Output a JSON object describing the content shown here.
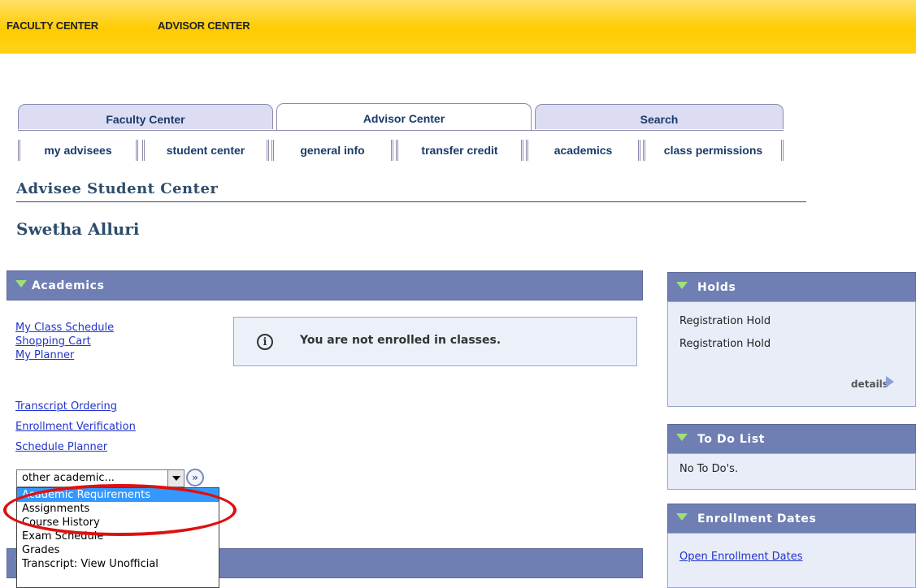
{
  "topbar": {
    "faculty_center": "FACULTY CENTER",
    "advisor_center": "ADVISOR CENTER"
  },
  "main_tabs": [
    {
      "label": "Faculty Center"
    },
    {
      "label": "Advisor Center"
    },
    {
      "label": "Search"
    }
  ],
  "sub_tabs": [
    {
      "label": "my advisees"
    },
    {
      "label": "student center"
    },
    {
      "label": "general info"
    },
    {
      "label": "transfer credit"
    },
    {
      "label": "academics"
    },
    {
      "label": "class permissions"
    }
  ],
  "page": {
    "title": "Advisee Student Center",
    "student_name": "Swetha Alluri"
  },
  "academics": {
    "header": "Academics",
    "links_group1": [
      "My Class Schedule",
      "Shopping Cart",
      "My Planner"
    ],
    "links_group2": [
      "Transcript Ordering",
      "Enrollment Verification",
      "Schedule Planner"
    ],
    "info_message": "You are not enrolled in classes.",
    "info_icon": "i",
    "select_value": "other academic...",
    "go_icon": "»",
    "dropdown_options": [
      "Academic Requirements",
      "Assignments",
      "Course History",
      "Exam Schedule",
      "Grades",
      "Transcript: View Unofficial"
    ]
  },
  "holds": {
    "header": "Holds",
    "items": [
      "Registration Hold",
      "Registration Hold"
    ],
    "details": "details"
  },
  "todo": {
    "header": "To Do List",
    "empty_text": "No To Do's."
  },
  "enrollment_dates": {
    "header": "Enrollment Dates",
    "link": "Open Enrollment Dates"
  },
  "colors": {
    "topbar": "#ffcc00",
    "pane_header": "#6f7fb4",
    "link": "#2233cc",
    "highlight": "#dd1111"
  }
}
